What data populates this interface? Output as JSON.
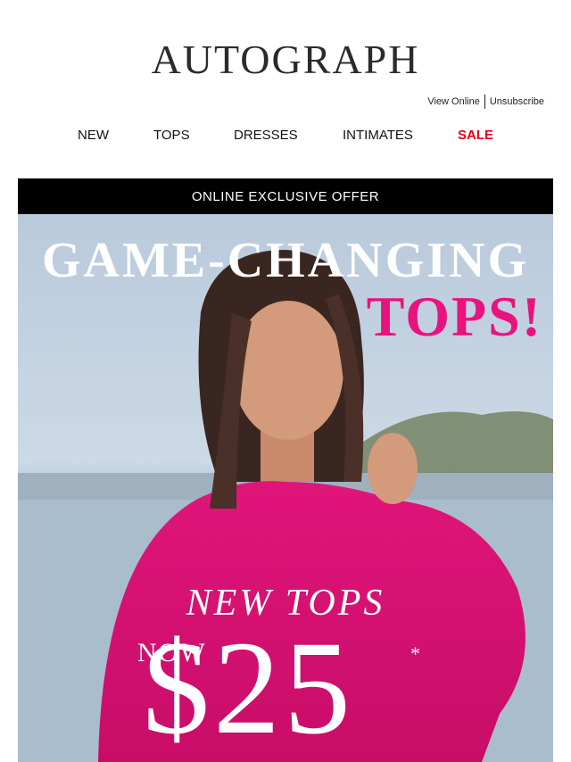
{
  "brand": {
    "logo_text": "AUTOGRAPH"
  },
  "utility_links": {
    "view_online": "View Online",
    "unsubscribe": "Unsubscribe"
  },
  "nav": {
    "items": [
      {
        "label": "NEW"
      },
      {
        "label": "TOPS"
      },
      {
        "label": "DRESSES"
      },
      {
        "label": "INTIMATES"
      },
      {
        "label": "SALE",
        "color": "#e3001b"
      }
    ]
  },
  "hero": {
    "banner": "ONLINE EXCLUSIVE OFFER",
    "headline_line1": "GAME-CHANGING",
    "headline_line2": "TOPS!",
    "promo_line": "NEW TOPS",
    "promo_now": "NOW",
    "promo_price": "$25",
    "promo_asterisk": "*",
    "accent_color": "#e8137e",
    "image_subject": "woman-in-pink-blouse-photo"
  }
}
